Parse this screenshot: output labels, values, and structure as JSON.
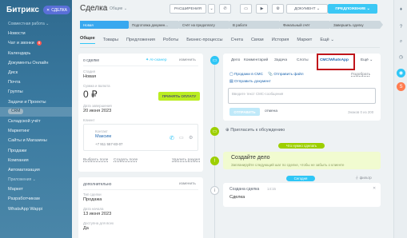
{
  "sidebar": {
    "logo": "Битрикс",
    "close_label": "СДЕЛКА",
    "items": [
      {
        "label": "Совместная работа ⌄",
        "type": "section"
      },
      {
        "label": "Новости",
        "type": "item"
      },
      {
        "label": "Чат и звонки",
        "type": "item",
        "badge": "8"
      },
      {
        "label": "Календарь",
        "type": "item"
      },
      {
        "label": "Документы Онлайн",
        "type": "item"
      },
      {
        "label": "Диск",
        "type": "item"
      },
      {
        "label": "Почта",
        "type": "item"
      },
      {
        "label": "Группы",
        "type": "item"
      },
      {
        "label": "Задачи и Проекты",
        "type": "item"
      },
      {
        "label": "CRM",
        "type": "crm"
      },
      {
        "label": "Складской учёт",
        "type": "item"
      },
      {
        "label": "Маркетинг",
        "type": "item"
      },
      {
        "label": "Сайты и Магазины",
        "type": "item"
      },
      {
        "label": "Продажи",
        "type": "item"
      },
      {
        "label": "Компания",
        "type": "item"
      },
      {
        "label": "Автоматизация",
        "type": "item"
      },
      {
        "label": "Приложения ⌄",
        "type": "section"
      },
      {
        "label": "Маркет",
        "type": "item"
      },
      {
        "label": "Разработчикам",
        "type": "item"
      },
      {
        "label": "WhatsApp Wappi",
        "type": "item"
      }
    ]
  },
  "header": {
    "title": "Сделка",
    "subtitle": "Общие",
    "btn_extensions": "РАСШИРЕНИЯ",
    "btn_document": "ДОКУМЕНТ",
    "btn_offer": "ПРЕДЛОЖЕНИЕ"
  },
  "stages": [
    {
      "label": "Новая",
      "color": "#39a8ef"
    },
    {
      "label": "Подготовка докумен...",
      "color": "#cdd8de"
    },
    {
      "label": "Счёт на предоплату",
      "color": "#cdd8de"
    },
    {
      "label": "В работе",
      "color": "#cdd8de"
    },
    {
      "label": "Финальный счёт",
      "color": "#cdd8de"
    },
    {
      "label": "Завершить сделку",
      "color": "#cdd8de"
    }
  ],
  "tabs": [
    "Общее",
    "Товары",
    "Предложения",
    "Роботы",
    "Бизнес-процессы",
    "Счета",
    "Связи",
    "История",
    "Маркет",
    "Ещё ⌄"
  ],
  "about": {
    "title": "о сделке",
    "copilot": "AI-сканер",
    "edit": "изменить",
    "stage_label": "Стадия",
    "stage_value": "Новая",
    "amount_label": "Сумма и валюта",
    "amount_value": "0 ₽",
    "pay_button": "ПРИНЯТЬ ОПЛАТУ",
    "date_label": "Дата завершения",
    "date_value": "20 июня 2023",
    "client_label": "Клиент",
    "contact_label": "Контакт",
    "contact_name": "Максим",
    "contact_phone": "+7 911 557-83-07",
    "choose_field": "Выбрать поле",
    "create_field": "Создать поле",
    "delete_section": "Удалить раздел"
  },
  "extra": {
    "title": "дополнительно",
    "edit": "изменить",
    "type_label": "Тип сделки",
    "type_value": "Продажа",
    "start_label": "Дата начала",
    "start_value": "13 июня 2023",
    "available_label": "Доступна для всех",
    "available_value": "Да"
  },
  "activity": {
    "tabs": [
      "Дело",
      "Комментарий",
      "Задача",
      "Слоты",
      "СМС/WhatsApp",
      "Ещё ⌄"
    ],
    "active_tab": "СМС/WhatsApp",
    "highlight_color": "#c0151b",
    "sms_links": [
      "Продажи в СМС",
      "Отправить файл",
      "Подобрать"
    ],
    "send_doc": "Отправить документ",
    "placeholder": "Введите текст СМС-сообщения",
    "send_btn": "ОТПРАВИТЬ",
    "cancel": "отмена",
    "counter": "Знаков 0 из 200"
  },
  "timeline": {
    "invite": "Пригласить к обсуждению",
    "need_todo": "Что нужно сделать",
    "create_todo_title": "Создайте дело",
    "create_todo_hint": "Запланируйте следующий шаг по сделке, чтобы не забыть о клиенте",
    "today": "Сегодня",
    "filter": "фильтр",
    "event_title": "Создана сделка",
    "event_time": "14:15",
    "event_body": "Сделка"
  }
}
